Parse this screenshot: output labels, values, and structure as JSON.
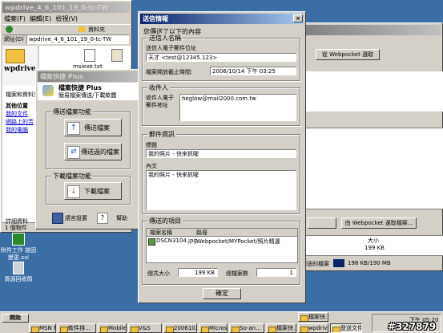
{
  "explorer": {
    "title": "wpdrive_4_6_101_19_0-tc-TW",
    "menu": [
      "檔案(F)",
      "編輯(E)",
      "檢視(V)"
    ],
    "toolbar_folder_label": "資料夾",
    "address_label": "網址(D)",
    "address_value": "wpdrive_4_6_101_19_0-tc-TW",
    "folder_title": "wpdrive_4_6_101_19_0-tc-TW",
    "files": [
      "msiexe.txt",
      "setup"
    ],
    "side_heading": "檔案和資料夾工作",
    "side_heading2": "其他位置",
    "side_links": [
      "我的文件",
      "網路上的芳",
      "我的電腦"
    ],
    "side_detail": "詳細資料",
    "status": "1 個物件"
  },
  "panel": {
    "title": "檔案快捷 Plus",
    "heading": "檔案快捷 Plus",
    "subheading": "簡易檔案傳送/下載軟體",
    "send_group": "傳送檔案功能",
    "send_btn": "傳送檔案",
    "sent_btn": "傳送過的檔案",
    "dl_group": "下載檔案功能",
    "dl_btn": "下載檔案",
    "lang_btn": "語言設置",
    "help_btn": "幫助"
  },
  "dialog": {
    "title": "送信情報",
    "intro": "您傳送了以下的內容",
    "sender_group": "送信人名稱",
    "sender_email_label": "送信人電子郵件位址",
    "sender_value": "天才 <test@12345.123>",
    "expiry_label": "檔案開放截止時間:",
    "expiry_value": "2006/10/14 下午 03:25",
    "recipient_group": "收件人",
    "recipient_email_label": "收件人電子郵件地址",
    "recipient_value": "heglow@mail2000.com.tw",
    "mail_group": "郵件資訊",
    "subject_label": "標題",
    "subject_value": "我的照片 - 快來抓喔",
    "body_label": "內文",
    "body_value": "我的照片 - 快來抓喔",
    "items_group": "傳送的項目",
    "col_name": "檔案名稱",
    "col_path": "路徑",
    "file_name": "DSCN3104.jpg",
    "file_path": "Webpocket/MYPocket/照片精選",
    "total_label": "總共大小",
    "total_value": "199 KB",
    "count_label": "總檔案數",
    "count_value": "1",
    "ok_btn": "確定"
  },
  "right_window": {
    "webpocket_btn": "從 Webpocket 選取",
    "webpocket_btn2": "由 Webpocket 選取檔案...",
    "col_size": "大小",
    "size_value": "199 KB",
    "send_status": "傳送的檔案",
    "quota": "198 KB/190 MB"
  },
  "desktop": {
    "icons": [
      "附件工作 諾固變更.xsl",
      "資源回收筒"
    ]
  },
  "taskbar": {
    "start": "開始",
    "items": [
      "MSN M...",
      "軟件排...",
      "Mobile0...",
      "V&S",
      "200610...",
      "Microso...",
      "So-an...",
      "檔案快...",
      "檔案快...",
      "wpdriv...",
      "發送文件"
    ],
    "clock": "下午 05:20"
  },
  "watermark": "#327879"
}
